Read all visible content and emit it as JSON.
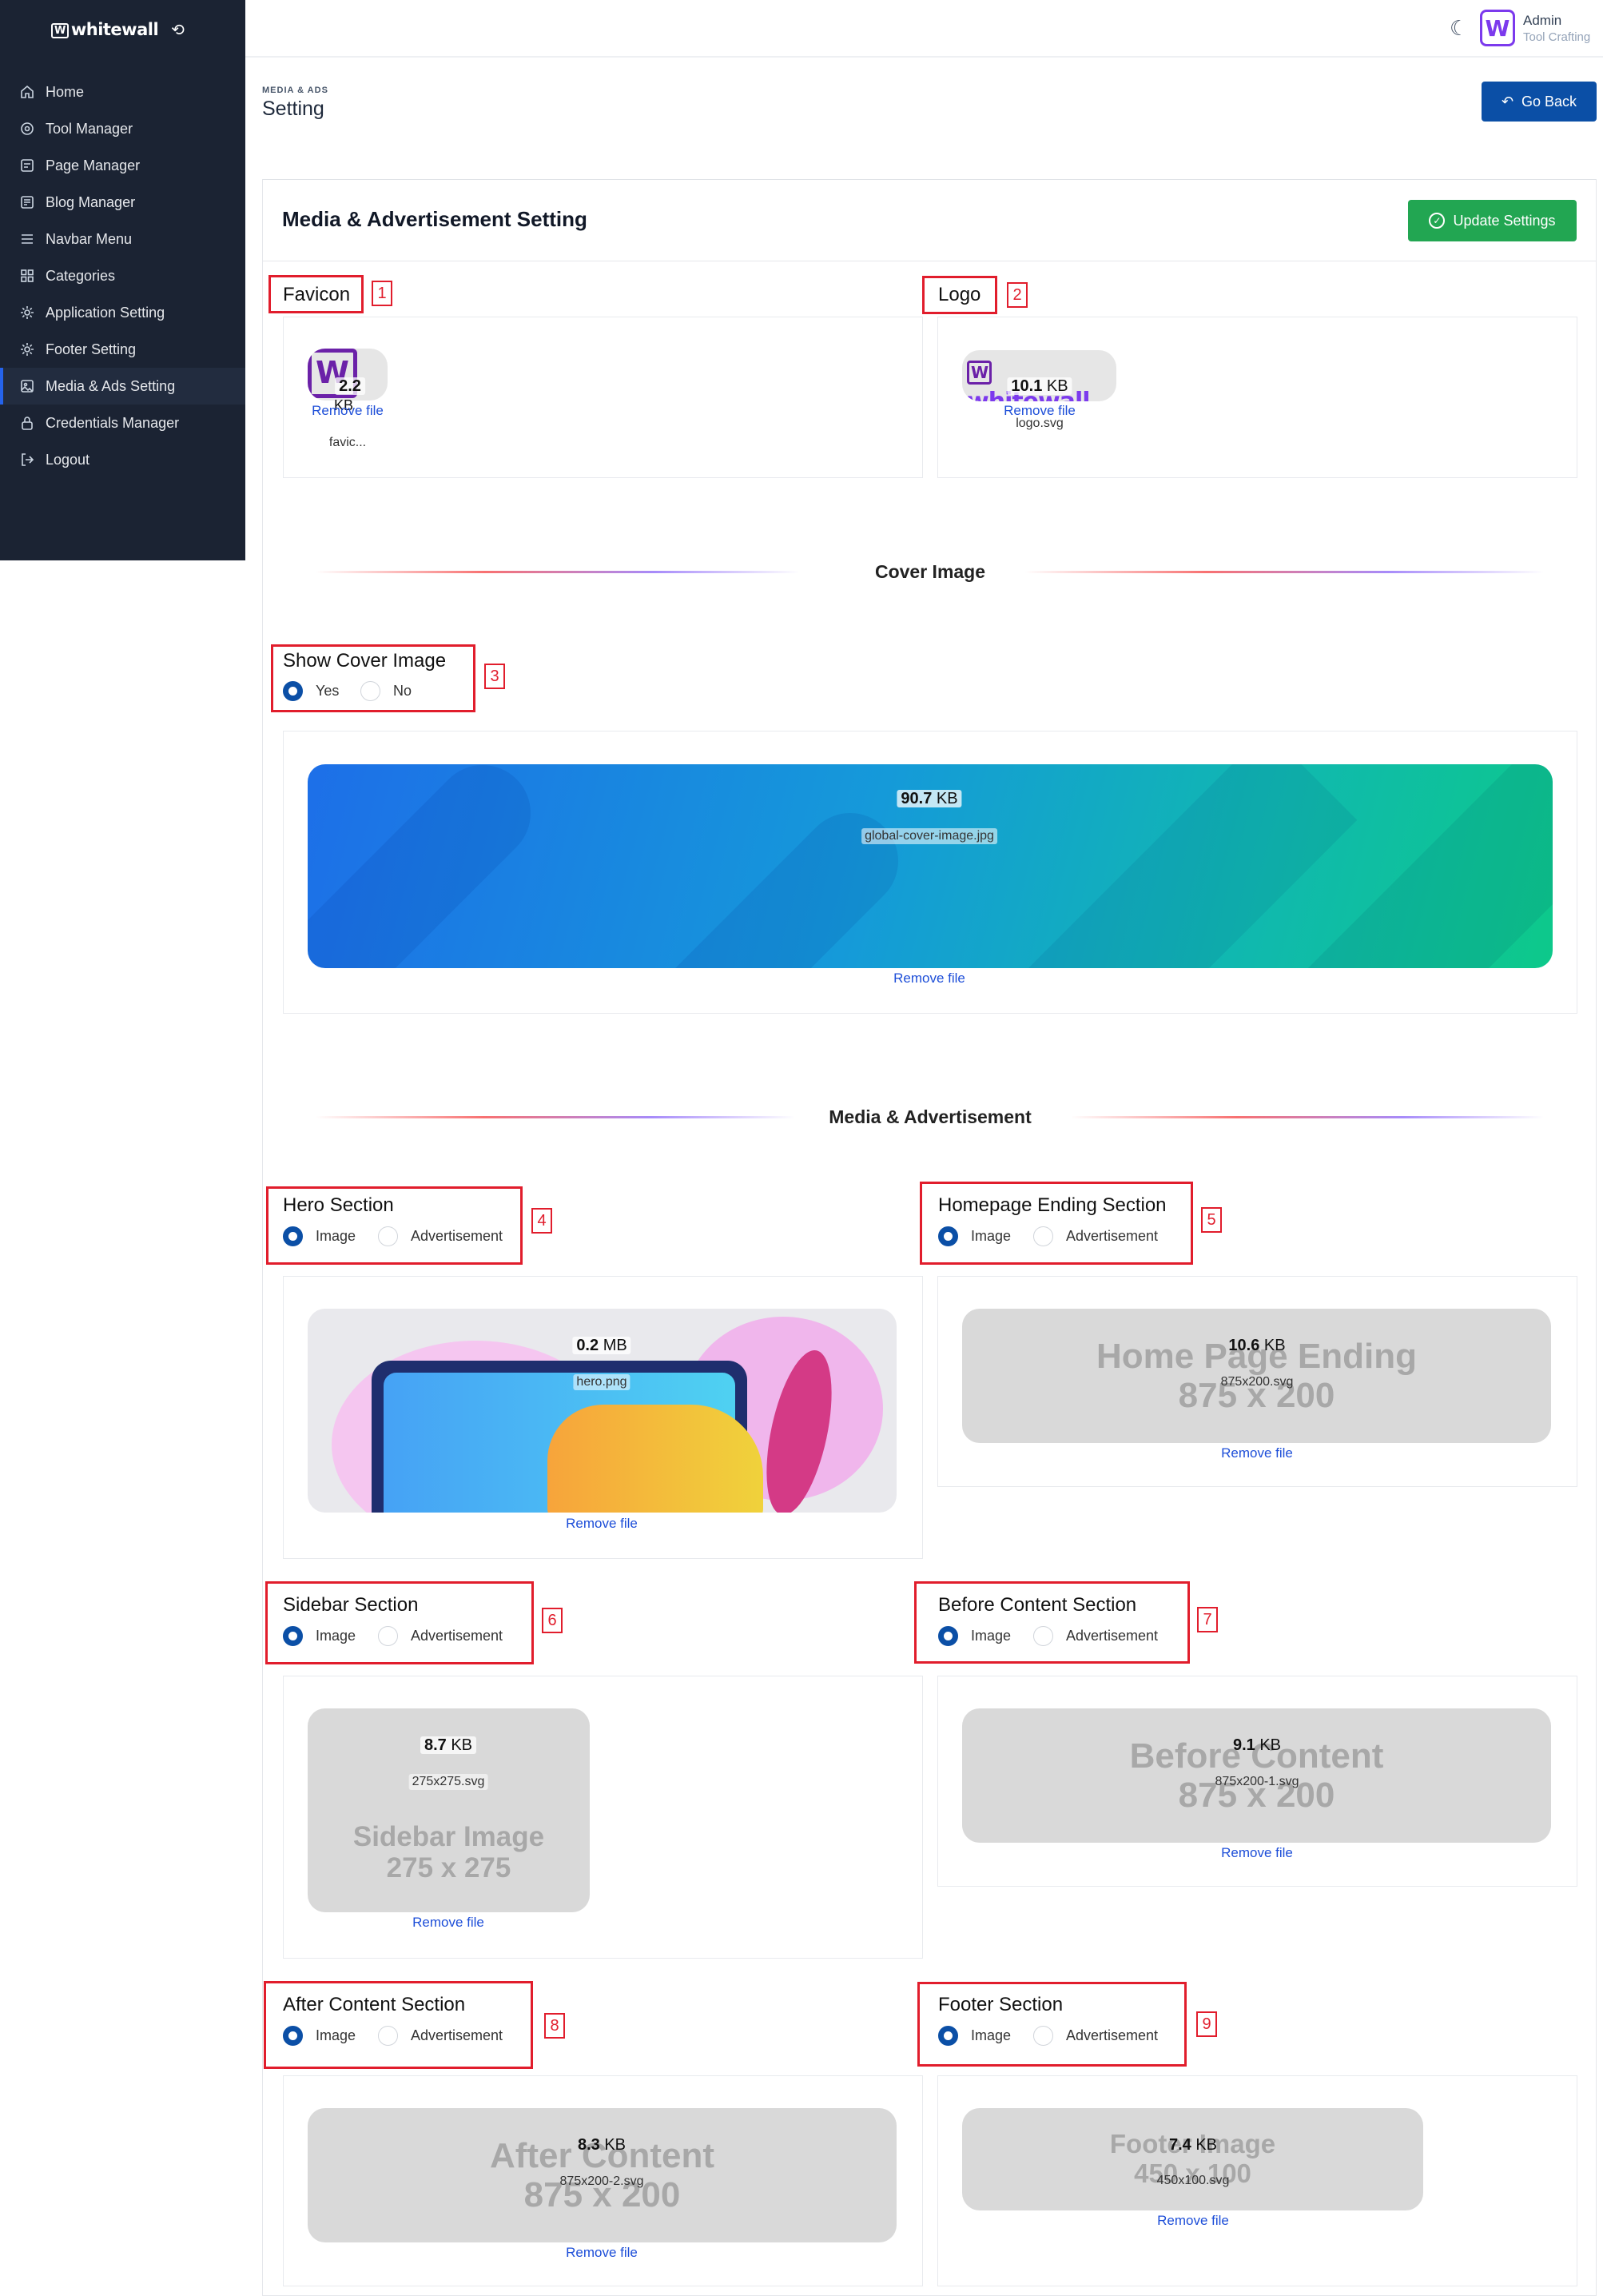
{
  "brand": {
    "name": "whitewall",
    "mark": "W"
  },
  "sidebar": {
    "items": [
      {
        "label": "Home",
        "icon": "home-icon"
      },
      {
        "label": "Tool Manager",
        "icon": "tool-icon"
      },
      {
        "label": "Page Manager",
        "icon": "page-icon"
      },
      {
        "label": "Blog Manager",
        "icon": "blog-icon"
      },
      {
        "label": "Navbar Menu",
        "icon": "menu-icon"
      },
      {
        "label": "Categories",
        "icon": "grid-icon"
      },
      {
        "label": "Application Setting",
        "icon": "gear-icon"
      },
      {
        "label": "Footer Setting",
        "icon": "gear-icon"
      },
      {
        "label": "Media & Ads Setting",
        "icon": "image-icon",
        "active": true
      },
      {
        "label": "Credentials Manager",
        "icon": "lock-icon"
      },
      {
        "label": "Logout",
        "icon": "logout-icon"
      }
    ]
  },
  "topbar": {
    "user_name": "Admin",
    "user_role": "Tool Crafting"
  },
  "page": {
    "breadcrumb": "MEDIA & ADS",
    "title": "Setting",
    "go_back": "Go Back"
  },
  "card": {
    "title": "Media & Advertisement Setting",
    "update_button": "Update Settings"
  },
  "favicon": {
    "label": "Favicon",
    "marker": "1",
    "size_num": "2.2",
    "size_unit": "KB",
    "filename": "favic...",
    "remove": "Remove file"
  },
  "logo": {
    "label": "Logo",
    "marker": "2",
    "size_num": "10.1",
    "size_unit": "KB",
    "filename": "logo.svg",
    "remove": "Remove file"
  },
  "cover_divider": {
    "title": "Cover Image"
  },
  "show_cover": {
    "label": "Show Cover Image",
    "marker": "3",
    "yes": "Yes",
    "no": "No",
    "selected": "Yes"
  },
  "cover": {
    "size_num": "90.7",
    "size_unit": "KB",
    "filename": "global-cover-image.jpg",
    "remove": "Remove file"
  },
  "media_divider": {
    "title": "Media & Advertisement"
  },
  "option_image": "Image",
  "option_ad": "Advertisement",
  "sections": {
    "hero": {
      "label": "Hero Section",
      "marker": "4",
      "size_num": "0.2",
      "size_unit": "MB",
      "filename": "hero.png",
      "remove": "Remove file"
    },
    "home_end": {
      "label": "Homepage Ending Section",
      "marker": "5",
      "size_num": "10.6",
      "size_unit": "KB",
      "filename": "875x200.svg",
      "remove": "Remove file",
      "ph1": "Home Page Ending",
      "ph2": "875 x 200"
    },
    "sidebar": {
      "label": "Sidebar Section",
      "marker": "6",
      "size_num": "8.7",
      "size_unit": "KB",
      "filename": "275x275.svg",
      "remove": "Remove file",
      "ph1": "Sidebar Image",
      "ph2": "275 x 275"
    },
    "before": {
      "label": "Before Content Section",
      "marker": "7",
      "size_num": "9.1",
      "size_unit": "KB",
      "filename": "875x200-1.svg",
      "remove": "Remove file",
      "ph1": "Before Content",
      "ph2": "875 x 200"
    },
    "after": {
      "label": "After Content Section",
      "marker": "8",
      "size_num": "8.3",
      "size_unit": "KB",
      "filename": "875x200-2.svg",
      "remove": "Remove file",
      "ph1": "After Content",
      "ph2": "875 x 200"
    },
    "footer": {
      "label": "Footer Section",
      "marker": "9",
      "size_num": "7.4",
      "size_unit": "KB",
      "filename": "450x100.svg",
      "remove": "Remove file",
      "ph1": "Footer Image",
      "ph2": "450 x 100"
    }
  },
  "colors": {
    "sidebar_bg": "#1b2333",
    "primary": "#0b4fa6",
    "success": "#22a652",
    "annotation": "#e11d2c",
    "accent_purple": "#7c3aed"
  }
}
